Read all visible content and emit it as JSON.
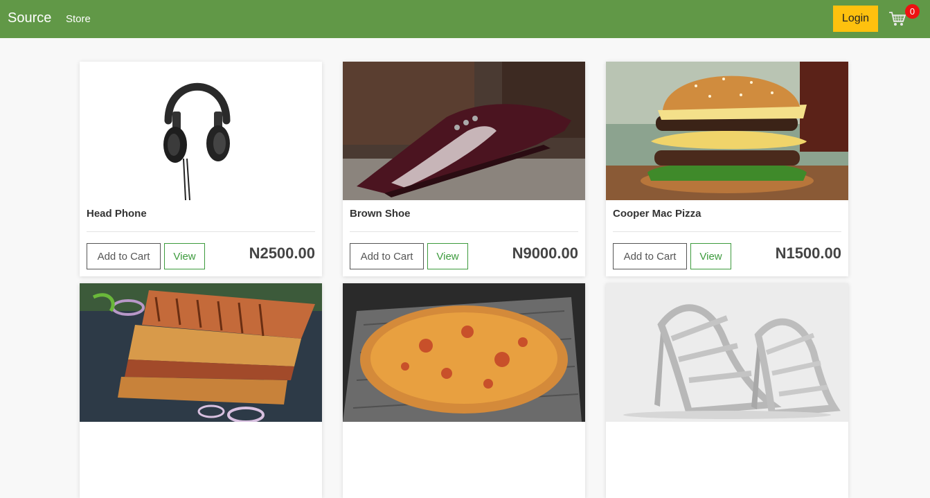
{
  "navbar": {
    "brand": "Source",
    "links": [
      "Store"
    ],
    "login_label": "Login",
    "cart_count": "0",
    "color": "#619847",
    "login_color": "#fec10e"
  },
  "buttons": {
    "add_to_cart": "Add to Cart",
    "view": "View"
  },
  "products": [
    {
      "name": "Head Phone",
      "price": "N2500.00",
      "image": "headphone-image"
    },
    {
      "name": "Brown Shoe",
      "price": "N9000.00",
      "image": "shoe-image"
    },
    {
      "name": "Cooper Mac Pizza",
      "price": "N1500.00",
      "image": "burger-image"
    },
    {
      "name": "",
      "image": "sandwich-image"
    },
    {
      "name": "",
      "image": "pizza-image"
    },
    {
      "name": "",
      "image": "heels-image"
    }
  ]
}
